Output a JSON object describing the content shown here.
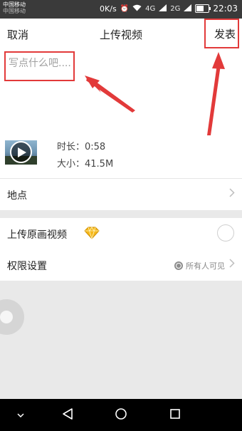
{
  "status_bar": {
    "carrier_primary": "中国移动",
    "carrier_secondary": "中国移动",
    "network_speed": "0K/s",
    "signal_4g": "4G",
    "signal_2g": "2G",
    "time": "22:03",
    "battery_level": 0.55
  },
  "header": {
    "cancel_label": "取消",
    "title": "上传视频",
    "publish_label": "发表"
  },
  "compose": {
    "placeholder": "写点什么吧...."
  },
  "video": {
    "duration": "时长：0:58",
    "size": "大小：41.5M"
  },
  "rows": {
    "location_label": "地点",
    "original_label": "上传原画视频",
    "permission_label": "权限设置",
    "permission_value": "所有人可见"
  },
  "colors": {
    "annotation_red": "#e23a3a"
  },
  "icons": {
    "diamond": "diamond-icon",
    "globe": "globe-icon",
    "chevron": "chevron-right-icon",
    "play": "play-icon"
  }
}
